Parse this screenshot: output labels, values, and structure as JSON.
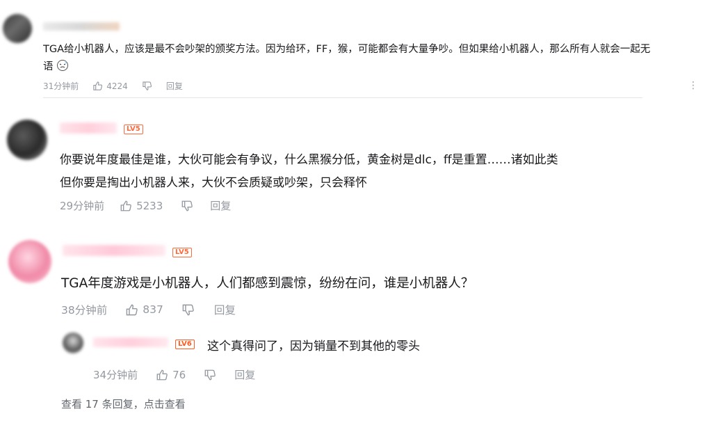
{
  "comments": [
    {
      "text_line1": "TGA给小机器人，应该是最不会吵架的颁奖方法。因为给环，FF，猴，可能都会有大量争吵。但如果给小机器人，那么所有人就会一起无",
      "text_line2": "语",
      "time": "31分钟前",
      "likes": "4224",
      "reply_label": "回复"
    },
    {
      "level": "LV5",
      "text_line1": "你要说年度最佳是谁，大伙可能会有争议，什么黑猴分低，黄金树是dlc，ff是重置……诸如此类",
      "text_line2": "但你要是掏出小机器人来，大伙不会质疑或吵架，只会释怀",
      "time": "29分钟前",
      "likes": "5233",
      "reply_label": "回复"
    },
    {
      "level": "LV5",
      "text_line1": "TGA年度游戏是小机器人，人们都感到震惊，纷纷在问，谁是小机器人？",
      "time": "38分钟前",
      "likes": "837",
      "reply_label": "回复",
      "sub_reply": {
        "level": "LV6",
        "text": "这个真得问了，因为销量不到其他的零头",
        "time": "34分钟前",
        "likes": "76",
        "reply_label": "回复"
      },
      "view_more": "查看 17 条回复，点击查看"
    }
  ]
}
